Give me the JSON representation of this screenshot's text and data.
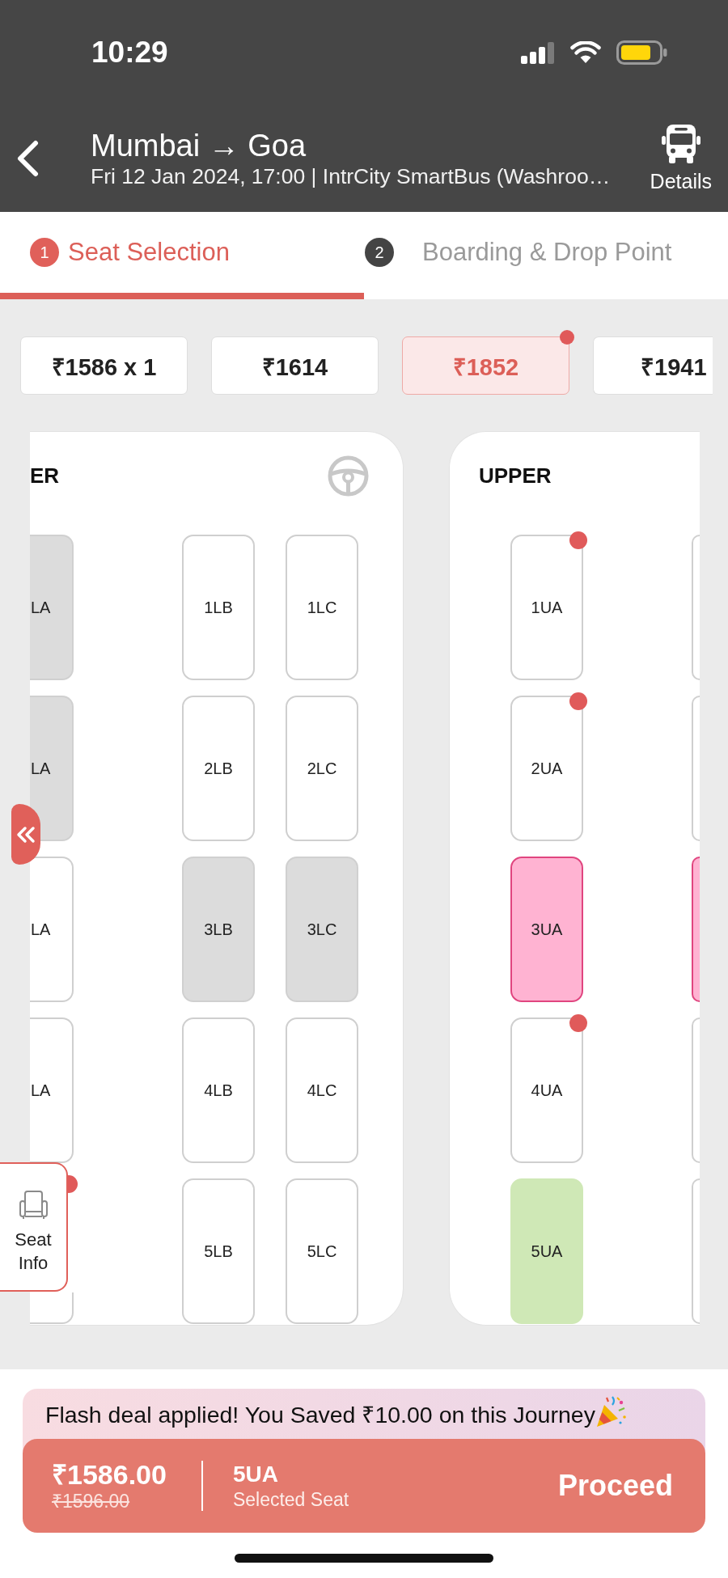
{
  "status_bar": {
    "time": "10:29"
  },
  "header": {
    "title": "Mumbai → Goa",
    "subtitle": "Fri 12 Jan 2024, 17:00 | IntrCity SmartBus (Washroo…",
    "details_label": "Details"
  },
  "steps": [
    {
      "number": "1",
      "label": "Seat Selection",
      "selected": true
    },
    {
      "number": "2",
      "label": "Boarding & Drop Point",
      "selected": false
    }
  ],
  "price_filters": [
    {
      "label": "₹1586 x 1",
      "selected": false,
      "dot": false
    },
    {
      "label": "₹1614",
      "selected": false,
      "dot": false
    },
    {
      "label": "₹1852",
      "selected": true,
      "dot": true
    },
    {
      "label": "₹1941",
      "selected": false,
      "dot": false
    }
  ],
  "decks": [
    {
      "title": "ER",
      "steering_wheel": true,
      "sides": [
        {
          "columns": [
            {
              "seats": [
                {
                  "label": "LA",
                  "booked": true,
                  "ladies": false,
                  "selected": false,
                  "dot": false
                },
                {
                  "label": "LA",
                  "booked": true,
                  "ladies": false,
                  "selected": false,
                  "dot": false
                },
                {
                  "label": "LA",
                  "booked": false,
                  "ladies": false,
                  "selected": false,
                  "dot": false
                },
                {
                  "label": "LA",
                  "booked": false,
                  "ladies": false,
                  "selected": false,
                  "dot": false
                },
                {
                  "booked": false,
                  "ladies": false,
                  "selected": false,
                  "dot": true
                }
              ]
            }
          ]
        },
        {
          "columns": [
            {
              "seats": [
                {
                  "label": "1LB",
                  "booked": false,
                  "ladies": false,
                  "selected": false,
                  "dot": false
                },
                {
                  "label": "2LB",
                  "booked": false,
                  "ladies": false,
                  "selected": false,
                  "dot": false
                },
                {
                  "label": "3LB",
                  "booked": true,
                  "ladies": false,
                  "selected": false,
                  "dot": false
                },
                {
                  "label": "4LB",
                  "booked": false,
                  "ladies": false,
                  "selected": false,
                  "dot": false
                },
                {
                  "label": "5LB",
                  "booked": false,
                  "ladies": false,
                  "selected": false,
                  "dot": false
                }
              ]
            },
            {
              "seats": [
                {
                  "label": "1LC",
                  "booked": false,
                  "ladies": false,
                  "selected": false,
                  "dot": false
                },
                {
                  "label": "2LC",
                  "booked": false,
                  "ladies": false,
                  "selected": false,
                  "dot": false
                },
                {
                  "label": "3LC",
                  "booked": true,
                  "ladies": false,
                  "selected": false,
                  "dot": false
                },
                {
                  "label": "4LC",
                  "booked": false,
                  "ladies": false,
                  "selected": false,
                  "dot": false
                },
                {
                  "label": "5LC",
                  "booked": false,
                  "ladies": false,
                  "selected": false,
                  "dot": false
                }
              ]
            }
          ]
        }
      ]
    },
    {
      "title": "UPPER",
      "steering_wheel": false,
      "sides": [
        {
          "columns": [
            {
              "seats": [
                {
                  "label": "1UA",
                  "booked": false,
                  "ladies": false,
                  "selected": false,
                  "dot": true
                },
                {
                  "label": "2UA",
                  "booked": false,
                  "ladies": false,
                  "selected": false,
                  "dot": true
                },
                {
                  "label": "3UA",
                  "booked": false,
                  "ladies": true,
                  "selected": false,
                  "dot": false
                },
                {
                  "label": "4UA",
                  "booked": false,
                  "ladies": false,
                  "selected": false,
                  "dot": true
                },
                {
                  "label": "5UA",
                  "booked": false,
                  "ladies": false,
                  "selected": true,
                  "dot": false
                }
              ]
            }
          ]
        },
        {
          "columns": [
            {
              "seats": [
                {
                  "booked": false,
                  "ladies": false,
                  "selected": false,
                  "dot": false
                },
                {
                  "booked": false,
                  "ladies": false,
                  "selected": false,
                  "dot": false
                },
                {
                  "booked": false,
                  "ladies": true,
                  "selected": false,
                  "dot": false
                },
                {
                  "booked": false,
                  "ladies": false,
                  "selected": false,
                  "dot": false
                },
                {
                  "booked": false,
                  "ladies": false,
                  "selected": false,
                  "dot": false
                }
              ]
            }
          ]
        }
      ]
    }
  ],
  "seat_info": {
    "label": "Seat Info"
  },
  "deal_banner": {
    "text": "Flash deal applied! You Saved ₹10.00 on this Journey"
  },
  "checkout": {
    "price": "₹1586.00",
    "original_price": "₹1596.00",
    "seat": "5UA",
    "seat_caption": "Selected Seat",
    "action": "Proceed"
  }
}
